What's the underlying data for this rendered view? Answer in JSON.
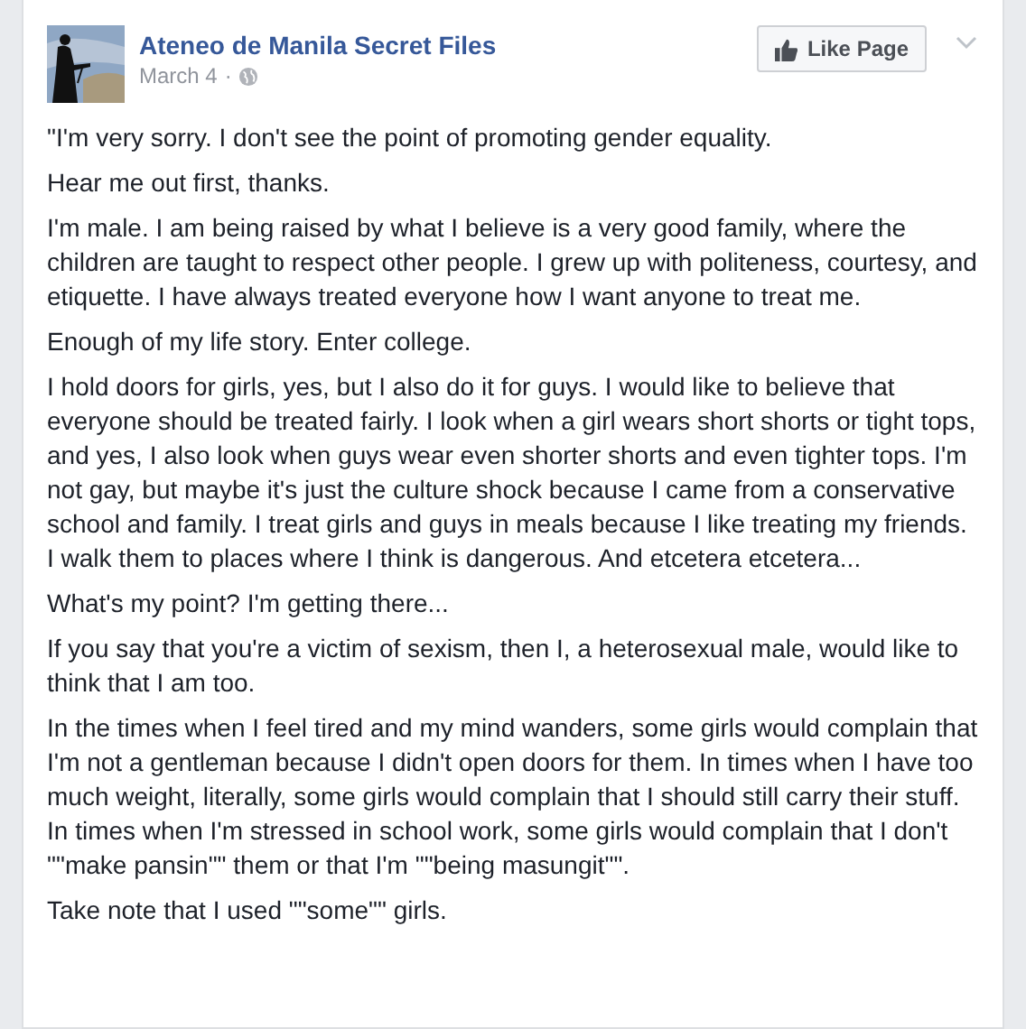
{
  "post": {
    "page_name": "Ateneo de Manila Secret Files",
    "date": "March 4",
    "separator": "·",
    "like_button": "Like Page",
    "paragraphs": [
      "\"I'm very sorry. I don't see the point of promoting gender equality.",
      "Hear me out first, thanks.",
      "I'm male. I am being raised by what I believe is a very good family, where the children are taught to respect other people. I grew up with politeness, courtesy, and etiquette. I have always treated everyone how I want anyone to treat me.",
      "Enough of my life story. Enter college.",
      "I hold doors for girls, yes, but I also do it for guys. I would like to believe that everyone should be treated fairly. I look when a girl wears short shorts or tight tops, and yes, I also look when guys wear even shorter shorts and even tighter tops. I'm not gay, but maybe it's just the culture shock because I came from a conservative school and family. I treat girls and guys in meals because I like treating my friends. I walk them to places where I think is dangerous. And etcetera etcetera...",
      "What's my point? I'm getting there...",
      "If you say that you're a victim of sexism, then I, a heterosexual male, would like to think that I am too.",
      "In the times when I feel tired and my mind wanders, some girls would complain that I'm not a gentleman because I didn't open doors for them. In times when I have too much weight, literally, some girls would complain that I should still carry their stuff. In times when I'm stressed in school work, some girls would complain that I don't \"\"make pansin\"\" them or that I'm \"\"being masungit\"\".",
      "Take note that I used \"\"some\"\" girls."
    ]
  }
}
